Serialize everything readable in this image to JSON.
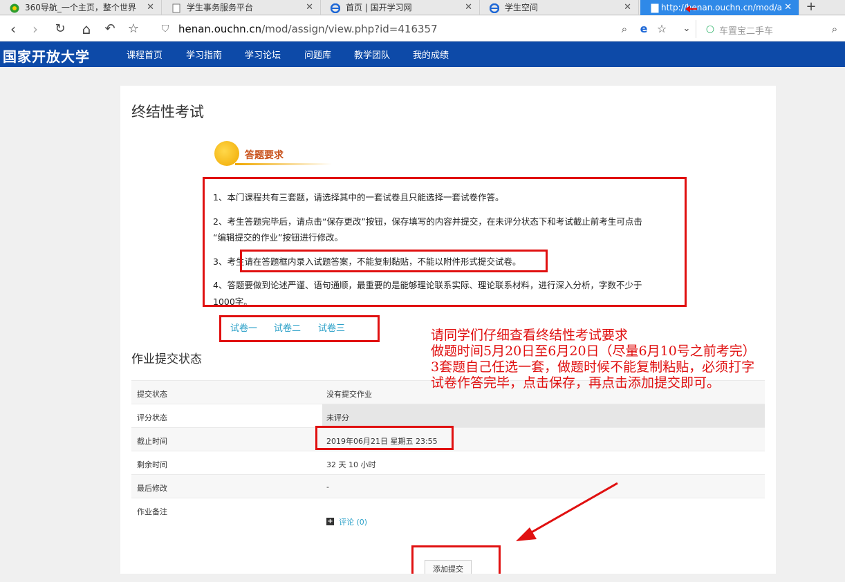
{
  "browser": {
    "tabs": [
      {
        "label": "360导航_一个主页，整个世界",
        "icon_color": "#2e9d2e"
      },
      {
        "label": "学生事务服务平台",
        "icon_color": "#8a8a8a"
      },
      {
        "label": "首页 | 国开学习网",
        "icon_color": "#1d67d6"
      },
      {
        "label": "学生空间",
        "icon_color": "#1d67d6"
      },
      {
        "label": "http://henan.ouchn.cn/mod/a",
        "icon_color": "#ffffff"
      }
    ],
    "tab_close": "✕",
    "new_tab": "+",
    "url_host": "henan.ouchn.cn",
    "url_path": "/mod/assign/view.php?id=416357",
    "search_placeholder": "车置宝二手车",
    "icons": [
      "back-icon",
      "forward-icon",
      "reload-icon",
      "home-icon",
      "undo-icon",
      "star-icon",
      "shield-icon",
      "zoom-icon",
      "ie-icon",
      "search-icon"
    ]
  },
  "site": {
    "logo": "国家开放大学",
    "menu": [
      "课程首页",
      "学习指南",
      "学习论坛",
      "问题库",
      "教学团队",
      "我的成绩"
    ],
    "brand_color": "#0d4aa8"
  },
  "page": {
    "title": "终结性考试",
    "req_title": "答题要求",
    "rules": [
      "1、本门课程共有三套题，请选择其中的一套试卷且只能选择一套试卷作答。",
      "2、考生答题完毕后，请点击“保存更改”按钮，保存填写的内容并提交，在未评分状态下和考试截止前考生可点击",
      "“编辑提交的作业”按钮进行修改。",
      "3、考生请在答题框内录入试题答案，不能复制黏贴，不能以附件形式提交试卷。",
      "4、答题要做到论述严谨、语句通顺，最重要的是能够理论联系实际、理论联系材料，进行深入分析，字数不少于",
      "1000字。"
    ],
    "papers": [
      "试卷一",
      "试卷二",
      "试卷三"
    ],
    "status_title": "作业提交状态",
    "status_rows": [
      {
        "label": "提交状态",
        "value": "没有提交作业"
      },
      {
        "label": "评分状态",
        "value": "未评分"
      },
      {
        "label": "截止时间",
        "value": "2019年06月21日 星期五 23:55"
      },
      {
        "label": "剩余时间",
        "value": "32 天 10 小时"
      },
      {
        "label": "最后修改",
        "value": "-"
      },
      {
        "label": "作业备注",
        "value": ""
      }
    ],
    "comment_link": "评论 (0)",
    "add_submission": "添加提交"
  },
  "annotation": {
    "color": "#e01010",
    "lines": [
      "请同学们仔细查看终结性考试要求",
      "做题时间5月20日至6月20日（尽量6月10号之前考完）",
      "3套题自己任选一套，做题时候不能复制粘贴，必须打字",
      "试卷作答完毕，点击保存，再点击添加提交即可。"
    ]
  }
}
